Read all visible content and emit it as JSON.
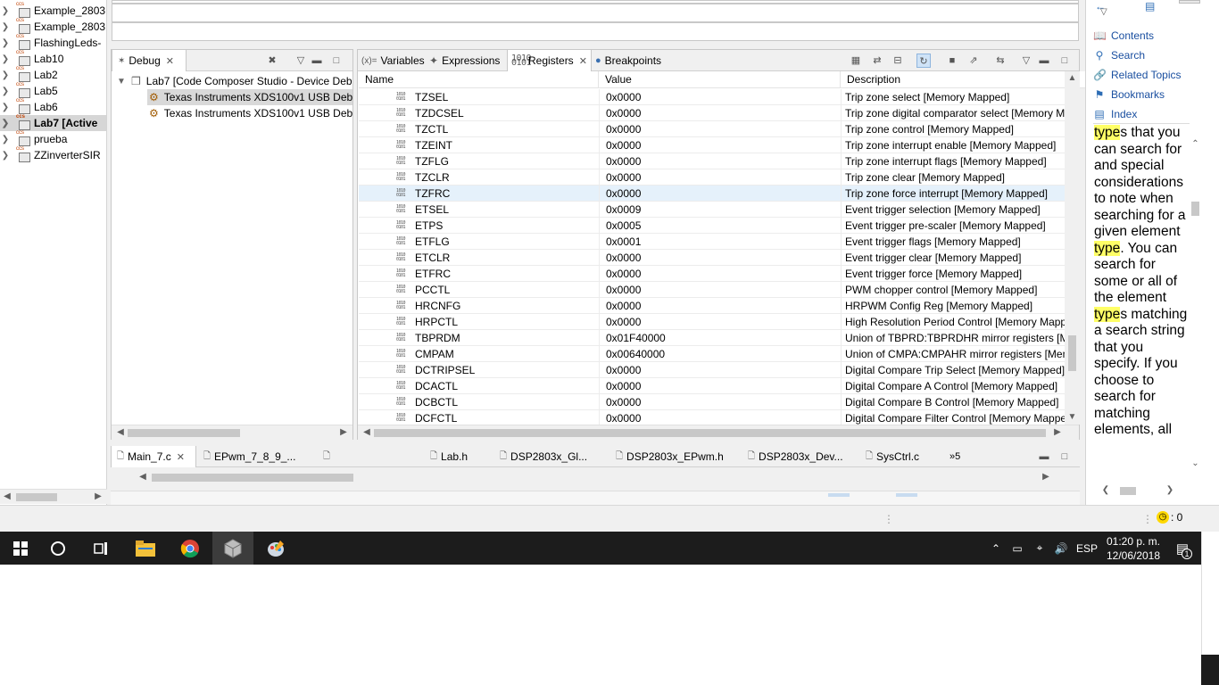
{
  "project_explorer": {
    "items": [
      {
        "label": "Example_2803",
        "active": false
      },
      {
        "label": "Example_2803",
        "active": false
      },
      {
        "label": "FlashingLeds-",
        "active": false
      },
      {
        "label": "Lab10",
        "active": false
      },
      {
        "label": "Lab2",
        "active": false
      },
      {
        "label": "Lab5",
        "active": false
      },
      {
        "label": "Lab6",
        "active": false
      },
      {
        "label": "Lab7  [Active",
        "active": true
      },
      {
        "label": "prueba",
        "active": false
      },
      {
        "label": "ZZinverterSIR",
        "active": false
      }
    ]
  },
  "debug_view": {
    "tab_label": "Debug",
    "tree": [
      {
        "label": "Lab7 [Code Composer Studio - Device Deb"
      },
      {
        "label": "Texas Instruments XDS100v1 USB Debug"
      },
      {
        "label": "Texas Instruments XDS100v1 USB Debug"
      }
    ]
  },
  "registers_view": {
    "tabs": [
      {
        "label": "Variables",
        "icon": "(x)="
      },
      {
        "label": "Expressions",
        "icon": "expressions"
      },
      {
        "label": "Registers",
        "icon": "1010"
      },
      {
        "label": "Breakpoints",
        "icon": "breakpoint"
      }
    ],
    "columns": [
      "Name",
      "Value",
      "Description"
    ],
    "rows": [
      {
        "name": "TZSEL",
        "value": "0x0000",
        "desc": "Trip zone select [Memory Mapped]"
      },
      {
        "name": "TZDCSEL",
        "value": "0x0000",
        "desc": "Trip zone digital comparator select [Memory M"
      },
      {
        "name": "TZCTL",
        "value": "0x0000",
        "desc": "Trip zone control [Memory Mapped]"
      },
      {
        "name": "TZEINT",
        "value": "0x0000",
        "desc": "Trip zone interrupt enable [Memory Mapped]"
      },
      {
        "name": "TZFLG",
        "value": "0x0000",
        "desc": "Trip zone interrupt flags [Memory Mapped]"
      },
      {
        "name": "TZCLR",
        "value": "0x0000",
        "desc": "Trip zone clear [Memory Mapped]"
      },
      {
        "name": "TZFRC",
        "value": "0x0000",
        "desc": "Trip zone force interrupt [Memory Mapped]",
        "selected": true
      },
      {
        "name": "ETSEL",
        "value": "0x0009",
        "desc": "Event trigger selection [Memory Mapped]"
      },
      {
        "name": "ETPS",
        "value": "0x0005",
        "desc": "Event trigger pre-scaler [Memory Mapped]"
      },
      {
        "name": "ETFLG",
        "value": "0x0001",
        "desc": "Event trigger flags [Memory Mapped]"
      },
      {
        "name": "ETCLR",
        "value": "0x0000",
        "desc": "Event trigger clear [Memory Mapped]"
      },
      {
        "name": "ETFRC",
        "value": "0x0000",
        "desc": "Event trigger force [Memory Mapped]"
      },
      {
        "name": "PCCTL",
        "value": "0x0000",
        "desc": "PWM chopper control [Memory Mapped]"
      },
      {
        "name": "HRCNFG",
        "value": "0x0000",
        "desc": "HRPWM Config Reg [Memory Mapped]"
      },
      {
        "name": "HRPCTL",
        "value": "0x0000",
        "desc": "High Resolution Period Control [Memory Mapp"
      },
      {
        "name": "TBPRDM",
        "value": "0x01F40000",
        "desc": "Union of TBPRD:TBPRDHR mirror registers [Me"
      },
      {
        "name": "CMPAM",
        "value": "0x00640000",
        "desc": "Union of CMPA:CMPAHR mirror registers [Mem"
      },
      {
        "name": "DCTRIPSEL",
        "value": "0x0000",
        "desc": "Digital Compare Trip Select [Memory Mapped]"
      },
      {
        "name": "DCACTL",
        "value": "0x0000",
        "desc": "Digital Compare A Control [Memory Mapped]"
      },
      {
        "name": "DCBCTL",
        "value": "0x0000",
        "desc": "Digital Compare B Control [Memory Mapped]"
      },
      {
        "name": "DCFCTL",
        "value": "0x0000",
        "desc": "Digital Compare Filter Control [Memory Mappe"
      }
    ]
  },
  "editor_tabs": [
    {
      "label": "Main_7.c",
      "active": true
    },
    {
      "label": "EPwm_7_8_9_..."
    },
    {
      "label": ""
    },
    {
      "label": "Lab.h"
    },
    {
      "label": "DSP2803x_Gl..."
    },
    {
      "label": "DSP2803x_EPwm.h"
    },
    {
      "label": "DSP2803x_Dev..."
    },
    {
      "label": "SysCtrl.c"
    }
  ],
  "editor_overflow": "»5",
  "help": {
    "links": [
      "Contents",
      "Search",
      "Related Topics",
      "Bookmarks",
      "Index"
    ],
    "text_parts": [
      {
        "t": "type",
        "hl": true
      },
      {
        "t": "s that you can search for and special considerations to note when searching for a given element ",
        "hl": false
      },
      {
        "t": "type",
        "hl": true
      },
      {
        "t": ". You can search for some or all of the element ",
        "hl": false
      },
      {
        "t": "type",
        "hl": true
      },
      {
        "t": "s matching a search string that you specify. If you choose to search for matching elements, all",
        "hl": false
      }
    ]
  },
  "status": {
    "right": ": 0"
  },
  "taskbar": {
    "lang": "ESP",
    "time": "01:20 p. m.",
    "date": "12/06/2018",
    "notifications": "1"
  }
}
